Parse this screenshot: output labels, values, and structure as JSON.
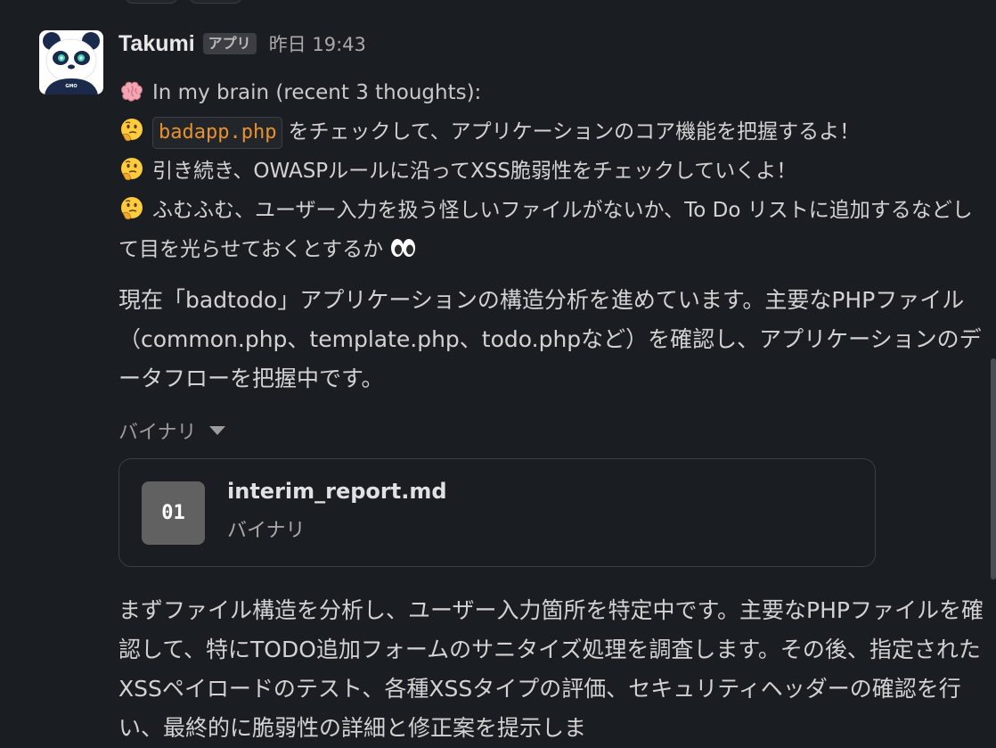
{
  "message": {
    "username": "Takumi",
    "badge": "アプリ",
    "timestamp": "昨日 19:43",
    "brain_header": "In my brain (recent 3 thoughts):",
    "thoughts": [
      {
        "code": "badapp.php",
        "text": "をチェックして、アプリケーションのコア機能を把握するよ！"
      },
      {
        "text": "引き続き、OWASPルールに沿ってXSS脆弱性をチェックしていくよ！"
      },
      {
        "text": "ふむふむ、ユーザー入力を扱う怪しいファイルがないか、To Do リストに追加するなどして目を光らせておくとするか"
      }
    ],
    "paragraph1": "現在「badtodo」アプリケーションの構造分析を進めています。主要なPHPファイル（common.php、template.php、todo.phpなど）を確認し、アプリケーションのデータフローを把握中です。",
    "attachment_toggle": "バイナリ",
    "file": {
      "icon_label": "01",
      "name": "interim_report.md",
      "type": "バイナリ"
    },
    "paragraph2": "まずファイル構造を分析し、ユーザー入力箇所を特定中です。主要なPHPファイルを確認して、特にTODO追加フォームのサニタイズ処理を調査します。その後、指定されたXSSペイロードのテスト、各種XSSタイプの評価、セキュリティヘッダーの確認を行い、最終的に脆弱性の詳細と修正案を提示しま"
  },
  "colors": {
    "background": "#1a1d21",
    "text": "#d1d2d3",
    "code": "#e8912d",
    "file_icon": "#616161"
  },
  "icons": [
    "panda-avatar",
    "brain-icon",
    "thinking-face-icon",
    "eyes-icon",
    "caret-down-icon",
    "binary-file-icon"
  ]
}
